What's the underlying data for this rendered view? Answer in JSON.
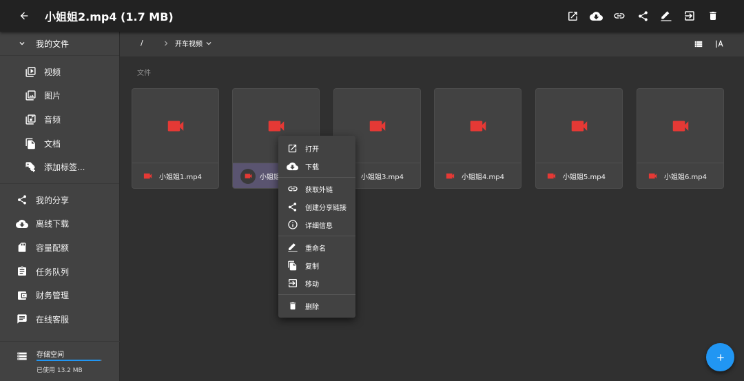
{
  "appbar": {
    "title": "小姐姐2.mp4 (1.7 MB)",
    "actions": [
      "open-external-icon",
      "download-icon",
      "link-icon",
      "share-icon",
      "rename-icon",
      "move-icon",
      "delete-icon"
    ]
  },
  "sidebar": {
    "my_files": "我的文件",
    "sub_items": [
      {
        "label": "视频",
        "icon": "video-library-icon"
      },
      {
        "label": "图片",
        "icon": "image-library-icon"
      },
      {
        "label": "音频",
        "icon": "audio-library-icon"
      },
      {
        "label": "文档",
        "icon": "documents-icon"
      },
      {
        "label": "添加标签...",
        "icon": "add-tag-icon"
      }
    ],
    "main_items": [
      {
        "label": "我的分享",
        "icon": "share-icon"
      },
      {
        "label": "离线下载",
        "icon": "cloud-download-icon"
      },
      {
        "label": "容量配额",
        "icon": "sd-card-icon"
      },
      {
        "label": "任务队列",
        "icon": "task-queue-icon"
      },
      {
        "label": "财务管理",
        "icon": "wallet-icon"
      },
      {
        "label": "在线客服",
        "icon": "chat-icon"
      }
    ],
    "storage": {
      "label": "存储空间",
      "used": "已使用 13.2 MB",
      "fill_fraction": 0.98
    }
  },
  "breadcrumb": {
    "root": "/",
    "current": "开车视频"
  },
  "content": {
    "section_label": "文件",
    "files": [
      {
        "name": "小姐姐1.mp4"
      },
      {
        "name": "小姐姐2.mp4"
      },
      {
        "name": "小姐姐3.mp4"
      },
      {
        "name": "小姐姐4.mp4"
      },
      {
        "name": "小姐姐5.mp4"
      },
      {
        "name": "小姐姐6.mp4"
      }
    ],
    "selected_display": "小姐姐"
  },
  "context_menu": {
    "groups": [
      [
        {
          "label": "打开",
          "icon": "open-external-icon"
        },
        {
          "label": "下载",
          "icon": "download-icon"
        }
      ],
      [
        {
          "label": "获取外链",
          "icon": "link-icon"
        },
        {
          "label": "创建分享链接",
          "icon": "share-icon"
        },
        {
          "label": "详细信息",
          "icon": "info-icon"
        }
      ],
      [
        {
          "label": "重命名",
          "icon": "rename-icon"
        },
        {
          "label": "复制",
          "icon": "copy-icon"
        },
        {
          "label": "移动",
          "icon": "move-icon"
        }
      ],
      [
        {
          "label": "删除",
          "icon": "delete-icon"
        }
      ]
    ]
  },
  "colors": {
    "accent": "#2196f3",
    "video_icon": "#e53935",
    "appbar": "#222222",
    "sidebar": "#424242",
    "background": "#303030"
  }
}
